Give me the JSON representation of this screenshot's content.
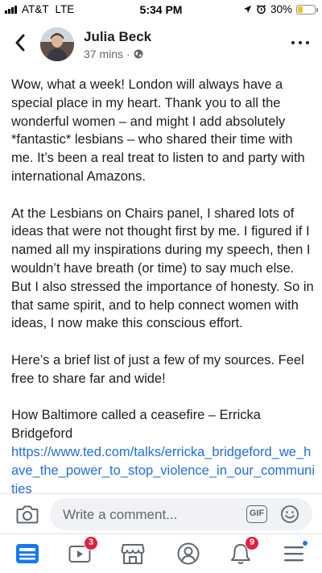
{
  "status_bar": {
    "carrier": "AT&T",
    "network": "LTE",
    "time": "5:34 PM",
    "battery_percent": "30%",
    "battery_level": 0.3,
    "battery_color": "#f5c518"
  },
  "post": {
    "author": "Julia Beck",
    "time_ago": "37 mins",
    "separator": "·",
    "privacy_icon": "globe-icon",
    "paragraphs": [
      "Wow, what a week! London will always have a special place in my heart. Thank you to all the wonderful women – and might I add absolutely *fantastic* lesbians – who shared their time with me. It’s been a real treat to listen to and party with international Amazons.",
      "At the Lesbians on Chairs panel, I shared lots of ideas that were not thought first by me. I figured if I named all my inspirations during my speech, then I wouldn’t have breath (or time) to say much else. But I also stressed the importance of honesty. So in that same spirit, and to help connect women with ideas, I now make this conscious effort.",
      "Here’s a brief list of just a few of my sources. Feel free to share far and wide!",
      "How Baltimore called a ceasefire – Erricka Bridgeford"
    ],
    "link": "https://www.ted.com/talks/erricka_bridgeford_we_have_the_power_to_stop_violence_in_our_communities"
  },
  "comment_bar": {
    "placeholder": "Write a comment...",
    "gif_label": "GIF"
  },
  "tab_bar": {
    "tabs": [
      {
        "name": "news-feed",
        "icon": "feed-icon",
        "active": true
      },
      {
        "name": "watch",
        "icon": "video-icon",
        "badge": "3"
      },
      {
        "name": "marketplace",
        "icon": "shop-icon"
      },
      {
        "name": "profile",
        "icon": "profile-icon"
      },
      {
        "name": "notifications",
        "icon": "bell-icon",
        "badge": "9"
      },
      {
        "name": "menu",
        "icon": "menu-icon",
        "dot": true
      }
    ]
  },
  "colors": {
    "accent": "#1877f2",
    "link": "#216fdb",
    "badge": "#e41e3f"
  }
}
